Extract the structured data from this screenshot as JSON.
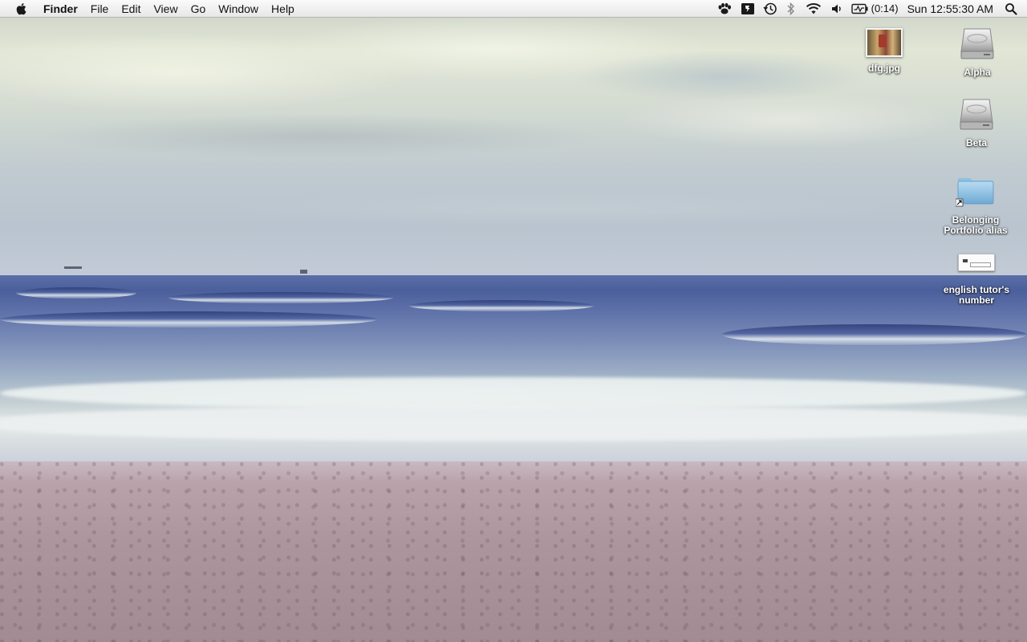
{
  "menubar": {
    "apple_icon": "apple-logo-icon",
    "app_name": "Finder",
    "menus": [
      "File",
      "Edit",
      "View",
      "Go",
      "Window",
      "Help"
    ],
    "status_icons": [
      "growl-paw-icon",
      "bartender-icon",
      "time-machine-icon",
      "bluetooth-icon",
      "wifi-icon",
      "volume-icon",
      "battery-icon"
    ],
    "battery_time": "(0:14)",
    "clock": "Sun 12:55:30 AM",
    "spotlight_icon": "spotlight-search-icon"
  },
  "desktop_icons": [
    {
      "label": "dfg.jpg",
      "icon": "image-file-icon"
    },
    {
      "label": "Alpha",
      "icon": "hard-drive-icon"
    },
    {
      "label": "Beta",
      "icon": "hard-drive-icon"
    },
    {
      "label": "Belonging Portfolio alias",
      "icon": "folder-alias-icon"
    },
    {
      "label": "english tutor's number",
      "icon": "document-icon"
    }
  ]
}
